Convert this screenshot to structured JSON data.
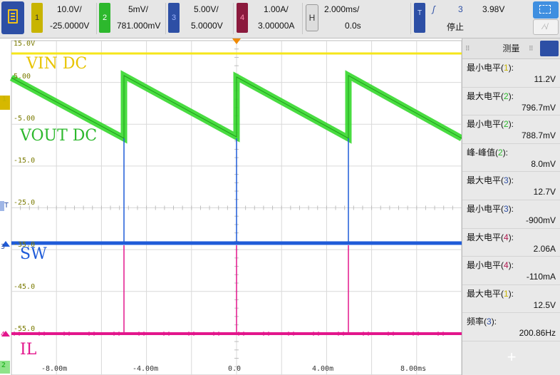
{
  "toolbar": {
    "ch1": {
      "number": "1",
      "scale": "10.0V/",
      "offset": "-25.0000V",
      "color": "#c8b400"
    },
    "ch2": {
      "number": "2",
      "scale": "5mV/",
      "offset": "781.000mV",
      "color": "#2db82d"
    },
    "ch3": {
      "number": "3",
      "scale": "5.00V/",
      "offset": "5.0000V",
      "color": "#2d4fa5"
    },
    "ch4": {
      "number": "4",
      "scale": "1.00A/",
      "offset": "3.00000A",
      "color": "#8b1a3d"
    },
    "horizontal": {
      "label": "H",
      "scale": "2.000ms/",
      "delay": "0.0s"
    },
    "trigger": {
      "label": "T",
      "edge_symbol": "ʃ",
      "source": "3",
      "level": "3.98V",
      "status": "停止"
    }
  },
  "scope": {
    "trace_colors": {
      "ch1": "#f5e61a",
      "ch2": "#35d82c",
      "ch3": "#1f5bd8",
      "ch4": "#e3168c"
    },
    "trace_labels": {
      "ch1": "VIN DC",
      "ch2": "VOUT DC",
      "ch3": "SW",
      "ch4": "IL"
    },
    "level_labels": [
      "15.0V",
      "5.00",
      "-5.00",
      "-15.0",
      "-25.0",
      "-35.0",
      "-45.0",
      "-55.0"
    ],
    "time_labels": [
      "-8.00m",
      "-4.00m",
      "0.0",
      "4.00m",
      "8.00ms"
    ],
    "marker_labels": {
      "ch1": "1",
      "ch2": "2",
      "trigger": "T",
      "ch3": "3",
      "ch4": "4"
    }
  },
  "measurements": {
    "title": "测量",
    "items": [
      {
        "label": "最小电平(",
        "ch": "1",
        "value": "11.2V"
      },
      {
        "label": "最大电平(",
        "ch": "2",
        "value": "796.7mV"
      },
      {
        "label": "最小电平(",
        "ch": "2",
        "value": "788.7mV"
      },
      {
        "label": "峰-峰值(",
        "ch": "2",
        "value": "8.0mV"
      },
      {
        "label": "最大电平(",
        "ch": "3",
        "value": "12.7V"
      },
      {
        "label": "最小电平(",
        "ch": "3",
        "value": "-900mV"
      },
      {
        "label": "最大电平(",
        "ch": "4",
        "value": "2.06A"
      },
      {
        "label": "最小电平(",
        "ch": "4",
        "value": "-110mA"
      },
      {
        "label": "最大电平(",
        "ch": "1",
        "value": "12.5V"
      },
      {
        "label": "频率(",
        "ch": "3",
        "value": "200.86Hz"
      }
    ],
    "add_label": "+"
  }
}
